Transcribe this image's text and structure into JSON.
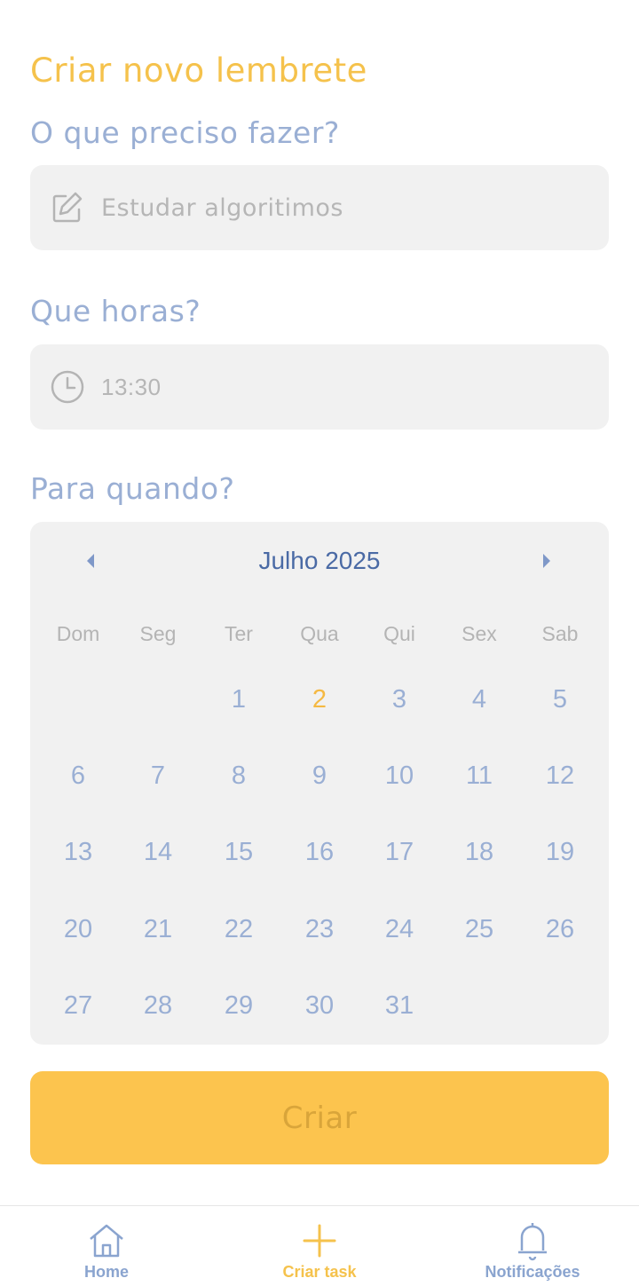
{
  "page": {
    "title": "Criar novo lembrete"
  },
  "task": {
    "label": "O que preciso fazer?",
    "placeholder": "Estudar algoritimos",
    "icon": "edit-icon"
  },
  "time": {
    "label": "Que horas?",
    "placeholder": "13:30",
    "icon": "clock-icon"
  },
  "date": {
    "label": "Para quando?"
  },
  "calendar": {
    "month_label": "Julho 2025",
    "weekdays": [
      "Dom",
      "Seg",
      "Ter",
      "Qua",
      "Qui",
      "Sex",
      "Sab"
    ],
    "first_weekday_index": 2,
    "days": [
      "1",
      "2",
      "3",
      "4",
      "5",
      "6",
      "7",
      "8",
      "9",
      "10",
      "11",
      "12",
      "13",
      "14",
      "15",
      "16",
      "17",
      "18",
      "19",
      "20",
      "21",
      "22",
      "23",
      "24",
      "25",
      "26",
      "27",
      "28",
      "29",
      "30",
      "31"
    ],
    "highlighted_day": "2",
    "prev_icon": "caret-left-icon",
    "next_icon": "caret-right-icon"
  },
  "create_button": {
    "label": "Criar"
  },
  "bottom_nav": {
    "items": [
      {
        "label": "Home",
        "icon": "home-icon",
        "active": false
      },
      {
        "label": "Criar task",
        "icon": "plus-icon",
        "active": true
      },
      {
        "label": "Notificações",
        "icon": "bell-icon",
        "active": false
      }
    ]
  },
  "colors": {
    "accent_yellow": "#f5c24c",
    "label_blue": "#9aafd4",
    "month_blue": "#4a6aa5",
    "field_bg": "#f1f1f1",
    "button_bg": "#fcc44e",
    "nav_inactive": "#8aa4cf"
  }
}
